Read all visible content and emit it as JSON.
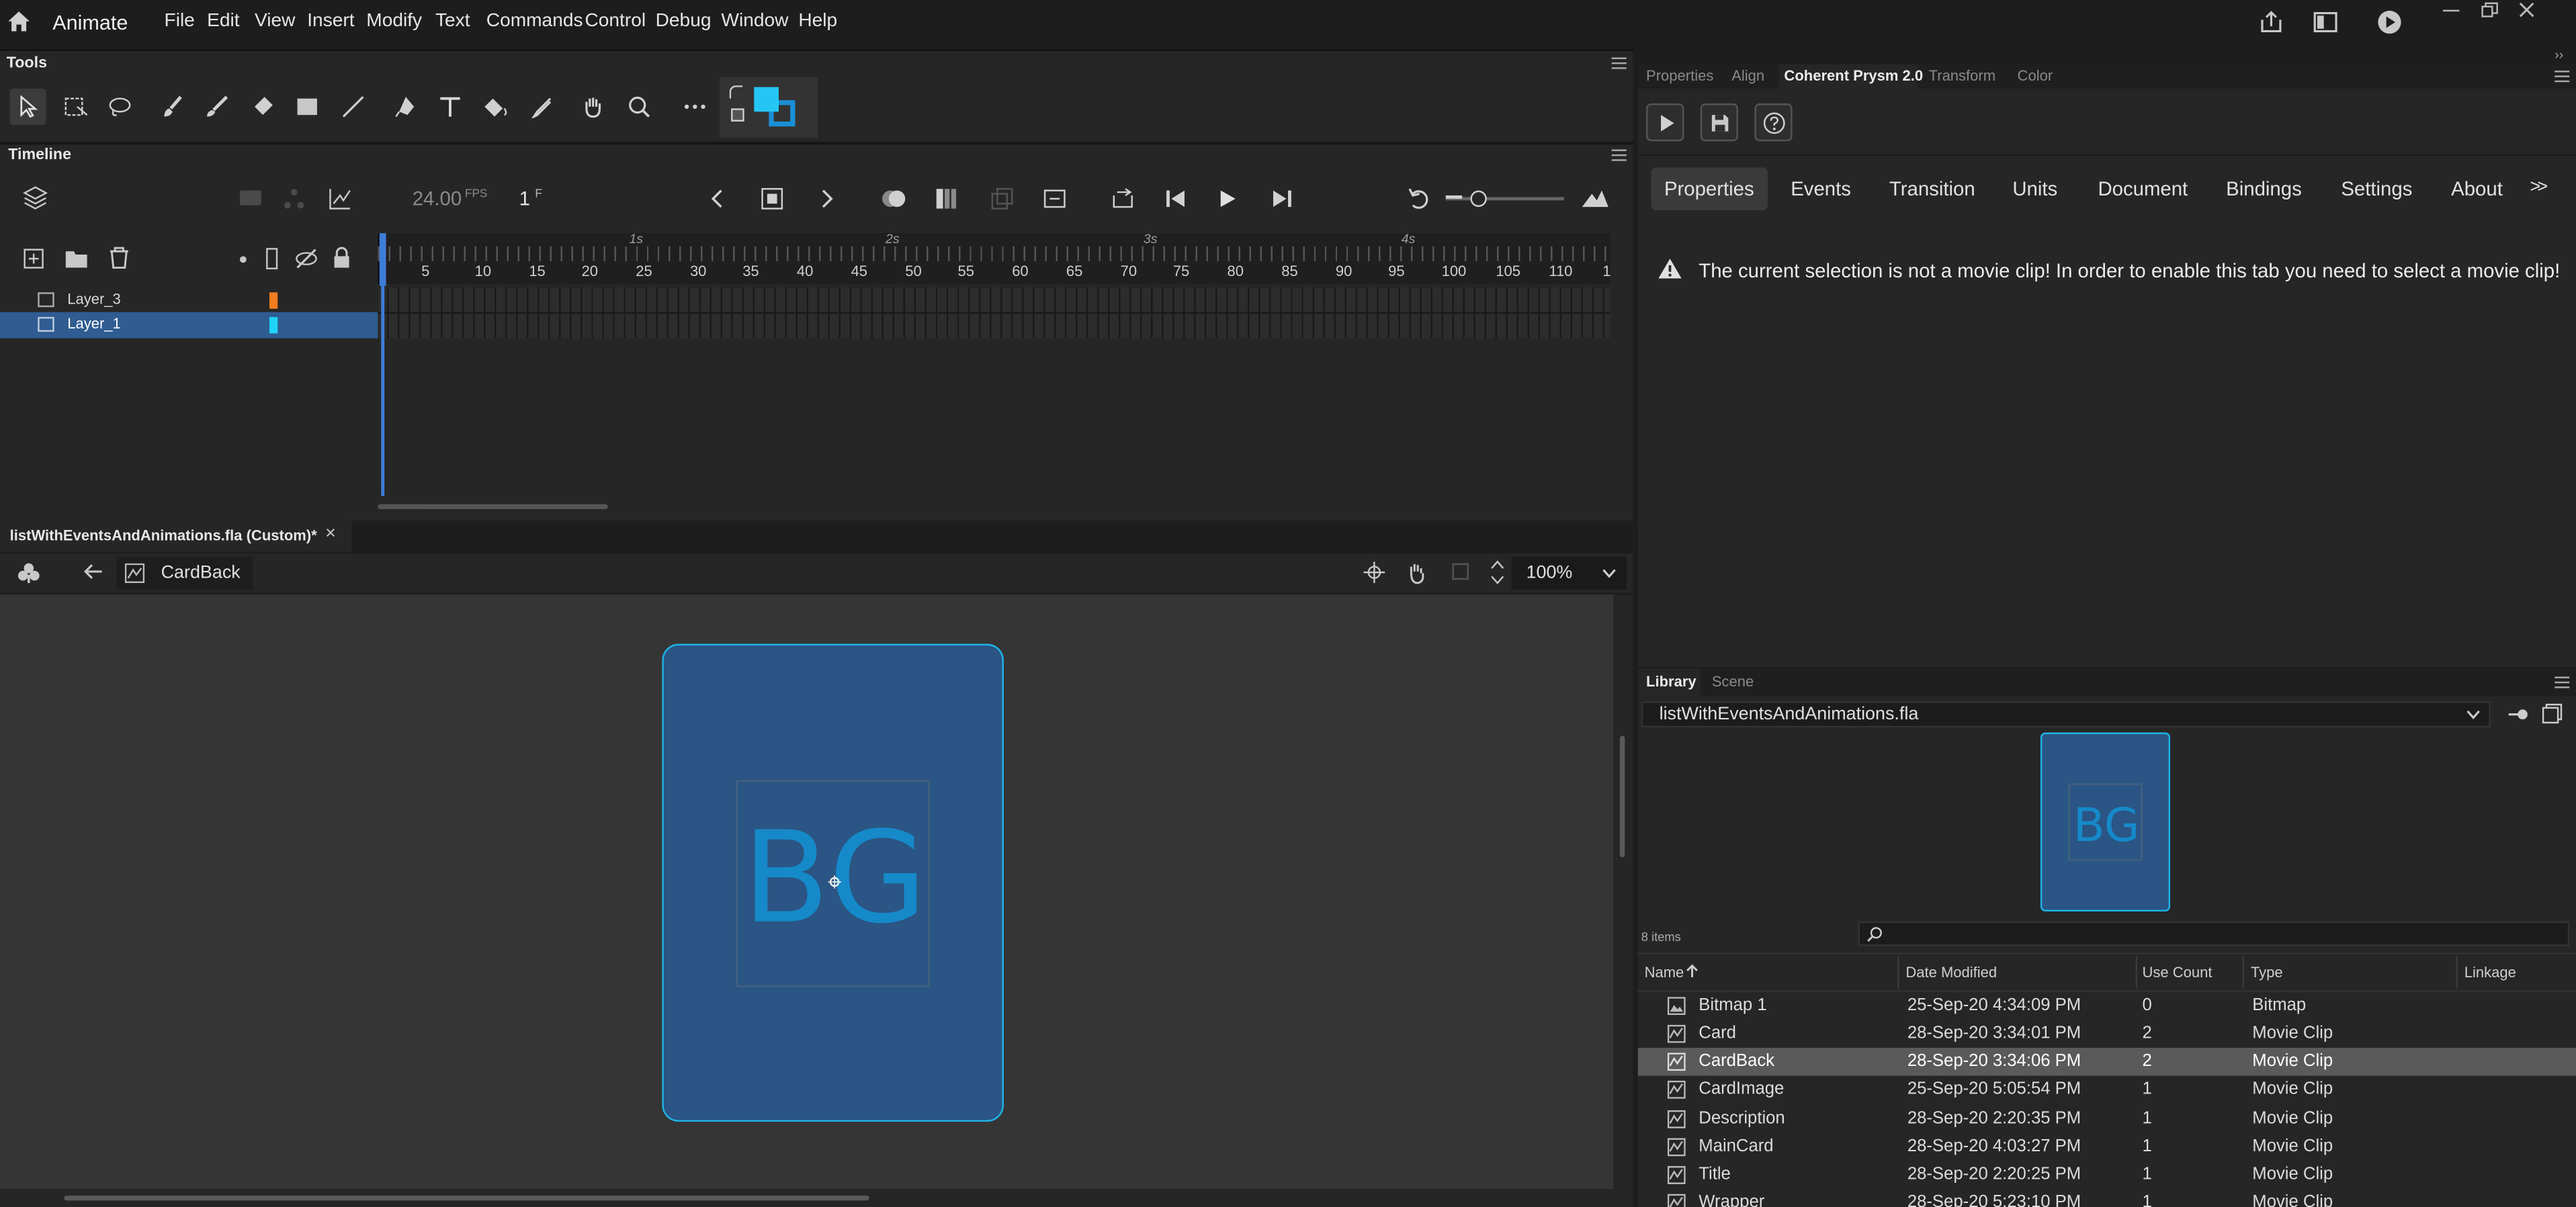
{
  "app": {
    "name": "Animate"
  },
  "menu": [
    "File",
    "Edit",
    "View",
    "Insert",
    "Modify",
    "Text",
    "Commands",
    "Control",
    "Debug",
    "Window",
    "Help"
  ],
  "tools_panel": {
    "title": "Tools"
  },
  "timeline": {
    "title": "Timeline",
    "fps": "24.00",
    "fps_unit": "FPS",
    "frame": "1",
    "frame_unit": "F",
    "seconds": [
      "1s",
      "2s",
      "3s",
      "4s"
    ],
    "ticks": [
      "5",
      "10",
      "15",
      "20",
      "25",
      "30",
      "35",
      "40",
      "45",
      "50",
      "55",
      "60",
      "65",
      "70",
      "75",
      "80",
      "85",
      "90",
      "95",
      "100",
      "105",
      "110",
      "1"
    ],
    "layers": [
      {
        "name": "Layer_3",
        "color": "#f07c1e",
        "selected": false
      },
      {
        "name": "Layer_1",
        "color": "#1fd2f5",
        "selected": true
      }
    ]
  },
  "document": {
    "tab_title": "listWithEventsAndAnimations.fla (Custom)*",
    "close": "×",
    "breadcrumb": "CardBack",
    "zoom": "100%",
    "symbol_text": "BG"
  },
  "panel_tabs": [
    "Properties",
    "Align",
    "Coherent Prysm 2.0",
    "Transform",
    "Color"
  ],
  "prysm": {
    "tabs": [
      "Properties",
      "Events",
      "Transition",
      "Units",
      "Document",
      "Bindings",
      "Settings",
      "About"
    ],
    "more": ">>",
    "warning": "The current selection is not a movie clip! In order to enable this tab you need to select a movie clip!"
  },
  "library": {
    "tabs": [
      "Library",
      "Scene"
    ],
    "file": "listWithEventsAndAnimations.fla",
    "preview_text": "BG",
    "count": "8 items",
    "columns": {
      "name": "Name",
      "date": "Date Modified",
      "use": "Use Count",
      "type": "Type",
      "linkage": "Linkage"
    },
    "items": [
      {
        "name": "Bitmap 1",
        "date": "25-Sep-20 4:34:09 PM",
        "use": "0",
        "type": "Bitmap",
        "icon": "bitmap-icon"
      },
      {
        "name": "Card",
        "date": "28-Sep-20 3:34:01 PM",
        "use": "2",
        "type": "Movie Clip",
        "icon": "movie-clip-icon"
      },
      {
        "name": "CardBack",
        "date": "28-Sep-20 3:34:06 PM",
        "use": "2",
        "type": "Movie Clip",
        "icon": "movie-clip-icon",
        "selected": true
      },
      {
        "name": "CardImage",
        "date": "25-Sep-20 5:05:54 PM",
        "use": "1",
        "type": "Movie Clip",
        "icon": "movie-clip-icon"
      },
      {
        "name": "Description",
        "date": "28-Sep-20 2:20:35 PM",
        "use": "1",
        "type": "Movie Clip",
        "icon": "movie-clip-icon"
      },
      {
        "name": "MainCard",
        "date": "28-Sep-20 4:03:27 PM",
        "use": "1",
        "type": "Movie Clip",
        "icon": "movie-clip-icon"
      },
      {
        "name": "Title",
        "date": "28-Sep-20 2:20:25 PM",
        "use": "1",
        "type": "Movie Clip",
        "icon": "movie-clip-icon"
      },
      {
        "name": "Wrapper",
        "date": "28-Sep-20 5:23:10 PM",
        "use": "1",
        "type": "Movie Clip",
        "icon": "movie-clip-icon"
      }
    ]
  },
  "colors": {
    "accent": "#1e6fc6",
    "stroke_swatch": "#1a8fd6",
    "fill_swatch": "#25c6f4",
    "card_fill": "#2a5584",
    "card_border": "#1eb3e6",
    "symbol_text": "#1689c9"
  }
}
